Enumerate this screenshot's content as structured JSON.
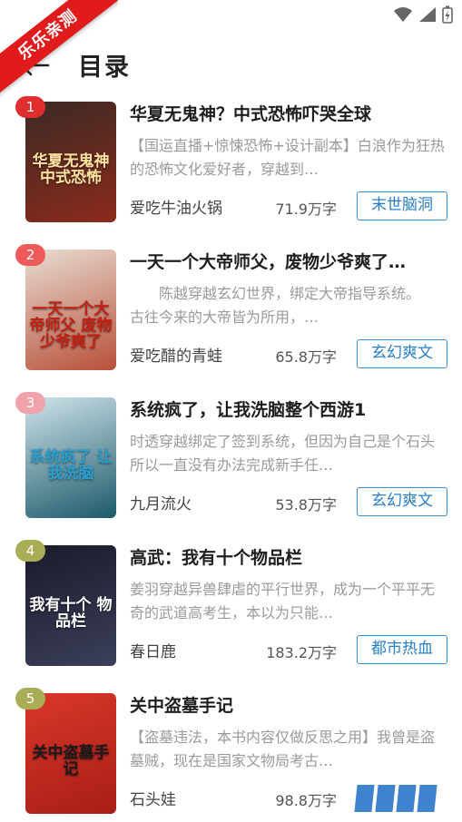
{
  "badge": {
    "label": "乐乐亲测",
    "color": "#e11b1b"
  },
  "header": {
    "title": "目录",
    "back_icon": "arrow-left-icon"
  },
  "status_bar": {
    "icons": [
      "wifi-icon",
      "signal-icon",
      "battery-charging-icon"
    ]
  },
  "books": [
    {
      "rank": "1",
      "rank_color": "#e02d2d",
      "title": "华夏无鬼神？中式恐怖吓哭全球",
      "description": "【国运直播+惊悚恐怖+设计副本】白浪作为狂热的恐怖文化爱好者，穿越到…",
      "author": "爱吃牛油火锅",
      "word_count": "71.9万字",
      "tag": "末世脑洞",
      "cover": {
        "text": "华夏无鬼神中式恐怖",
        "colors": [
          "#3b2a24",
          "#8c2a1c"
        ],
        "text_color": "#ffe2a0"
      }
    },
    {
      "rank": "2",
      "rank_color": "#ef5a5a",
      "title": "一天一个大帝师父，废物少爷爽了…",
      "description": "　　陈越穿越玄幻世界，绑定大帝指导系统。　　古往今来的大帝皆为所用，…",
      "author": "爱吃醋的青蛙",
      "word_count": "65.8万字",
      "tag": "玄幻爽文",
      "cover": {
        "text": "一天一个大帝师父 废物少爷爽了",
        "colors": [
          "#e8ddd2",
          "#b8503a"
        ],
        "text_color": "#c21f12"
      }
    },
    {
      "rank": "3",
      "rank_color": "#f1a3ab",
      "title": "系统疯了，让我洗脑整个西游1",
      "description": "时透穿越绑定了签到系统，但因为自己是个石头所以一直没有办法完成新手任…",
      "author": "九月流火",
      "word_count": "53.8万字",
      "tag": "玄幻爽文",
      "cover": {
        "text": "系统疯了 让我洗脑",
        "colors": [
          "#cfe3ea",
          "#1d5a6a"
        ],
        "text_color": "#2a9fd0"
      }
    },
    {
      "rank": "4",
      "rank_color": "#a9ad55",
      "title": "高武：我有十个物品栏",
      "description": "姜羽穿越异兽肆虐的平行世界，成为一个平平无奇的武道高考生，本以为只能…",
      "author": "春日鹿",
      "word_count": "183.2万字",
      "tag": "都市热血",
      "cover": {
        "text": "我有十个 物品栏",
        "colors": [
          "#1a1a2a",
          "#3b3f5a"
        ],
        "text_color": "#ffffff"
      }
    },
    {
      "rank": "5",
      "rank_color": "#a9ad55",
      "title": "关中盗墓手记",
      "description": "【盗墓违法，本书内容仅做反思之用】我曾是盗墓贼，现在是国家文物局考古…",
      "author": "石头娃",
      "word_count": "98.8万字",
      "tag": "",
      "cover": {
        "text": "关中盗墓手记",
        "colors": [
          "#d9372a",
          "#a81e16"
        ],
        "text_color": "#1a1a1a"
      }
    }
  ]
}
